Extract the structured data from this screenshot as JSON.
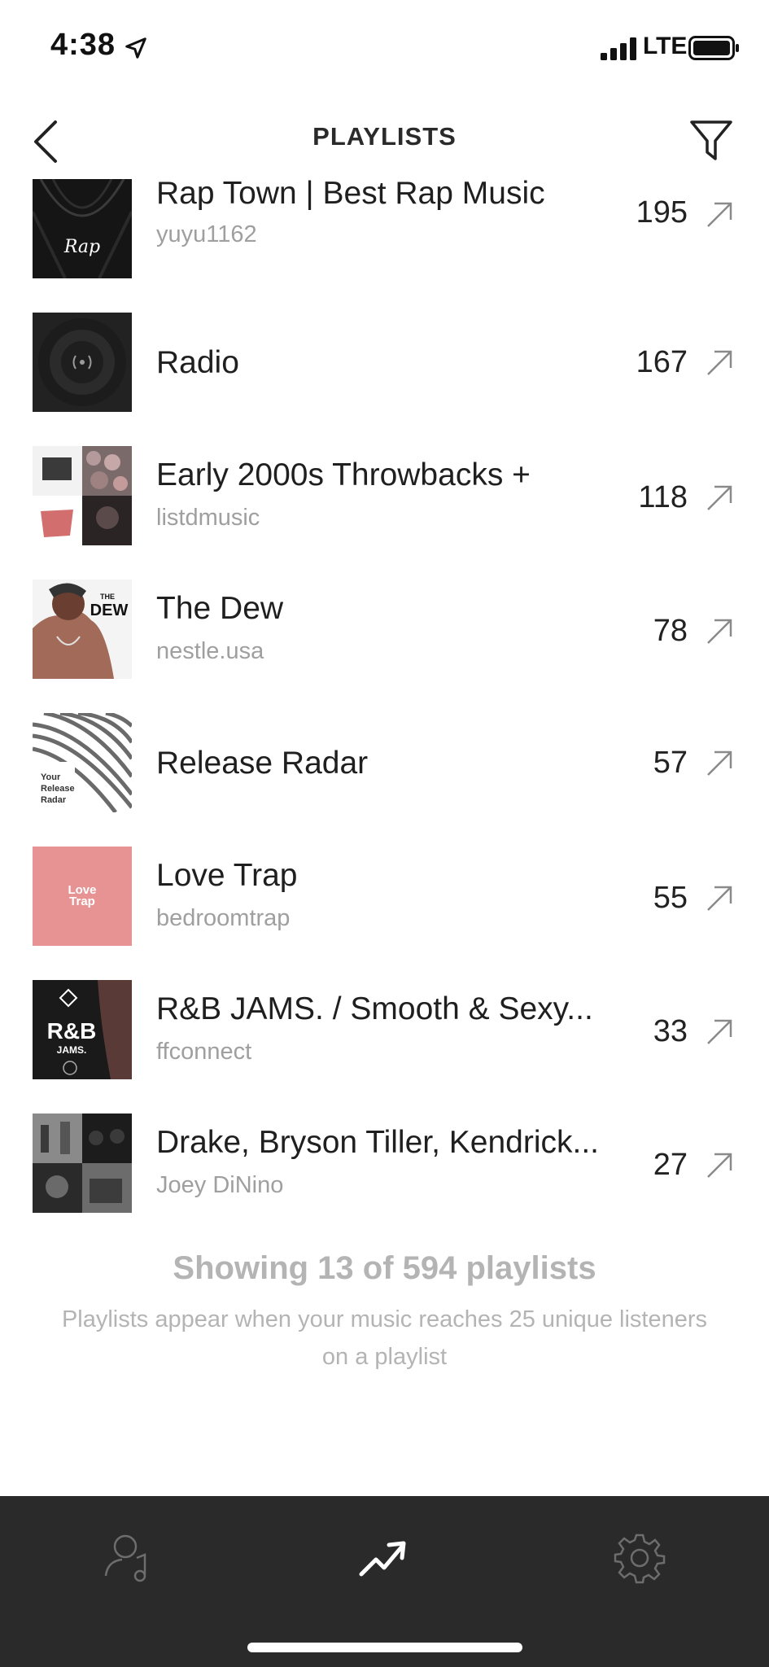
{
  "status_bar": {
    "time": "4:38",
    "network": "LTE",
    "icons": [
      "location-arrow-icon",
      "signal-icon",
      "battery-icon"
    ]
  },
  "header": {
    "title": "PLAYLISTS",
    "back_icon": "chevron-left-icon",
    "filter_icon": "filter-funnel-icon"
  },
  "playlists": [
    {
      "title": "Rap Town | Best Rap Music",
      "owner": "yuyu1162",
      "count": "195",
      "art": "dark-rap"
    },
    {
      "title": "Radio",
      "owner": "",
      "count": "167",
      "art": "radio"
    },
    {
      "title": "Early 2000s Throwbacks +",
      "owner": "listdmusic",
      "count": "118",
      "art": "collage"
    },
    {
      "title": "The Dew",
      "owner": "nestle.usa",
      "count": "78",
      "art": "dew"
    },
    {
      "title": "Release Radar",
      "owner": "",
      "count": "57",
      "art": "release-radar"
    },
    {
      "title": "Love Trap",
      "owner": "bedroomtrap",
      "count": "55",
      "art": "love-trap"
    },
    {
      "title": "R&B JAMS. / Smooth & Sexy...",
      "owner": "ffconnect",
      "count": "33",
      "art": "rnb"
    },
    {
      "title": "Drake, Bryson Tiller, Kendrick...",
      "owner": "Joey DiNino",
      "count": "27",
      "art": "collage-bw"
    }
  ],
  "art_text": {
    "rap": "Rap",
    "dew_small": "THE",
    "dew_big": "DEW",
    "release_radar": [
      "Your",
      "Release",
      "Radar"
    ],
    "love_trap": [
      "Love",
      "Trap"
    ],
    "rnb_big": "R&B",
    "rnb_small": "JAMS."
  },
  "footer": {
    "title": "Showing 13 of 594 playlists",
    "subtitle": "Playlists appear when your music reaches 25 unique listeners on a playlist"
  },
  "tab_bar": {
    "tabs": [
      {
        "icon": "artist-music-icon",
        "active": false
      },
      {
        "icon": "trending-up-icon",
        "active": true
      },
      {
        "icon": "gear-icon",
        "active": false
      }
    ]
  },
  "colors": {
    "tab_bar_bg": "#2a2a2a",
    "secondary_text": "#9f9f9f",
    "love_trap_pink": "#e79394"
  }
}
